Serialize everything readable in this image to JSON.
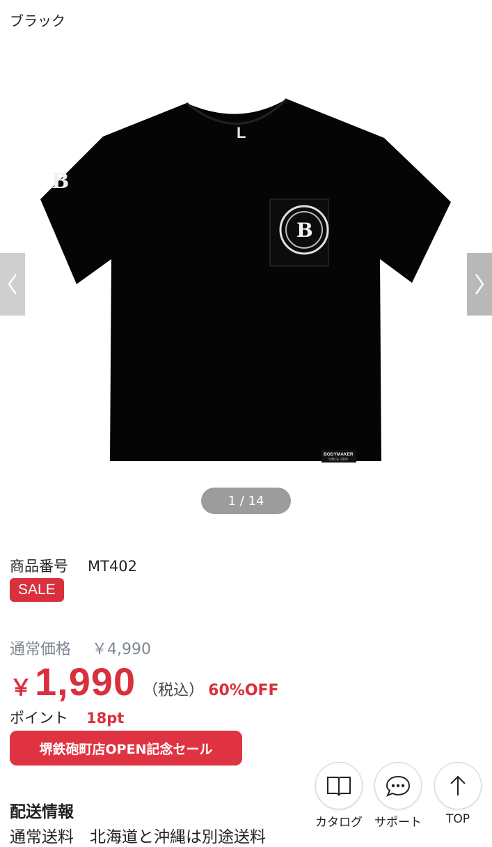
{
  "color_label": "ブラック",
  "gallery": {
    "pager": "1 / 14",
    "prev_icon": "chevron-left-icon",
    "next_icon": "chevron-right-icon",
    "shirt": {
      "color": "#000000",
      "size_print": "L",
      "sleeve_print": "B",
      "pocket_emblem_letter": "B",
      "tag_brand": "BODYMAKER",
      "tag_since": "SINCE 1999"
    }
  },
  "product": {
    "number_label": "商品番号",
    "number_value": "MT402",
    "sale_badge": "SALE",
    "regular_label": "通常価格",
    "regular_price": "￥4,990",
    "currency": "￥",
    "price": "1,990",
    "tax_note": "（税込）",
    "discount": "60%OFF",
    "points_label": "ポイント",
    "points_value": "18pt",
    "campaign_button": "堺鉄砲町店OPEN記念セール"
  },
  "shipping": {
    "title": "配送情報",
    "text": "通常送料　北海道と沖縄は別途送料"
  },
  "floating_buttons": [
    {
      "label": "カタログ",
      "icon": "book-icon"
    },
    {
      "label": "サポート",
      "icon": "chat-icon"
    },
    {
      "label": "TOP",
      "icon": "arrow-up-icon"
    }
  ],
  "colors": {
    "accent": "#d9303d",
    "muted": "#7f8893"
  }
}
